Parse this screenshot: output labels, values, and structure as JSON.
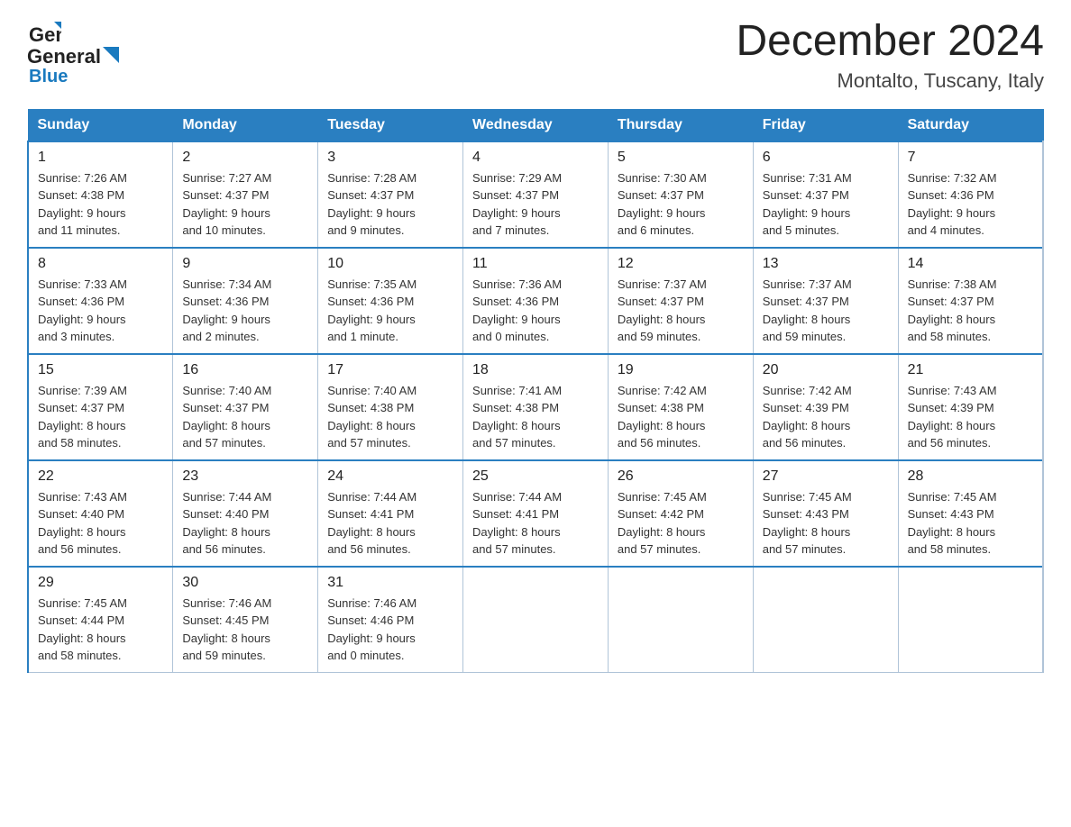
{
  "header": {
    "logo_general": "General",
    "logo_blue": "Blue",
    "title": "December 2024",
    "subtitle": "Montalto, Tuscany, Italy"
  },
  "days_of_week": [
    "Sunday",
    "Monday",
    "Tuesday",
    "Wednesday",
    "Thursday",
    "Friday",
    "Saturday"
  ],
  "weeks": [
    [
      {
        "day": "1",
        "sunrise": "7:26 AM",
        "sunset": "4:38 PM",
        "daylight": "9 hours and 11 minutes."
      },
      {
        "day": "2",
        "sunrise": "7:27 AM",
        "sunset": "4:37 PM",
        "daylight": "9 hours and 10 minutes."
      },
      {
        "day": "3",
        "sunrise": "7:28 AM",
        "sunset": "4:37 PM",
        "daylight": "9 hours and 9 minutes."
      },
      {
        "day": "4",
        "sunrise": "7:29 AM",
        "sunset": "4:37 PM",
        "daylight": "9 hours and 7 minutes."
      },
      {
        "day": "5",
        "sunrise": "7:30 AM",
        "sunset": "4:37 PM",
        "daylight": "9 hours and 6 minutes."
      },
      {
        "day": "6",
        "sunrise": "7:31 AM",
        "sunset": "4:37 PM",
        "daylight": "9 hours and 5 minutes."
      },
      {
        "day": "7",
        "sunrise": "7:32 AM",
        "sunset": "4:36 PM",
        "daylight": "9 hours and 4 minutes."
      }
    ],
    [
      {
        "day": "8",
        "sunrise": "7:33 AM",
        "sunset": "4:36 PM",
        "daylight": "9 hours and 3 minutes."
      },
      {
        "day": "9",
        "sunrise": "7:34 AM",
        "sunset": "4:36 PM",
        "daylight": "9 hours and 2 minutes."
      },
      {
        "day": "10",
        "sunrise": "7:35 AM",
        "sunset": "4:36 PM",
        "daylight": "9 hours and 1 minute."
      },
      {
        "day": "11",
        "sunrise": "7:36 AM",
        "sunset": "4:36 PM",
        "daylight": "9 hours and 0 minutes."
      },
      {
        "day": "12",
        "sunrise": "7:37 AM",
        "sunset": "4:37 PM",
        "daylight": "8 hours and 59 minutes."
      },
      {
        "day": "13",
        "sunrise": "7:37 AM",
        "sunset": "4:37 PM",
        "daylight": "8 hours and 59 minutes."
      },
      {
        "day": "14",
        "sunrise": "7:38 AM",
        "sunset": "4:37 PM",
        "daylight": "8 hours and 58 minutes."
      }
    ],
    [
      {
        "day": "15",
        "sunrise": "7:39 AM",
        "sunset": "4:37 PM",
        "daylight": "8 hours and 58 minutes."
      },
      {
        "day": "16",
        "sunrise": "7:40 AM",
        "sunset": "4:37 PM",
        "daylight": "8 hours and 57 minutes."
      },
      {
        "day": "17",
        "sunrise": "7:40 AM",
        "sunset": "4:38 PM",
        "daylight": "8 hours and 57 minutes."
      },
      {
        "day": "18",
        "sunrise": "7:41 AM",
        "sunset": "4:38 PM",
        "daylight": "8 hours and 57 minutes."
      },
      {
        "day": "19",
        "sunrise": "7:42 AM",
        "sunset": "4:38 PM",
        "daylight": "8 hours and 56 minutes."
      },
      {
        "day": "20",
        "sunrise": "7:42 AM",
        "sunset": "4:39 PM",
        "daylight": "8 hours and 56 minutes."
      },
      {
        "day": "21",
        "sunrise": "7:43 AM",
        "sunset": "4:39 PM",
        "daylight": "8 hours and 56 minutes."
      }
    ],
    [
      {
        "day": "22",
        "sunrise": "7:43 AM",
        "sunset": "4:40 PM",
        "daylight": "8 hours and 56 minutes."
      },
      {
        "day": "23",
        "sunrise": "7:44 AM",
        "sunset": "4:40 PM",
        "daylight": "8 hours and 56 minutes."
      },
      {
        "day": "24",
        "sunrise": "7:44 AM",
        "sunset": "4:41 PM",
        "daylight": "8 hours and 56 minutes."
      },
      {
        "day": "25",
        "sunrise": "7:44 AM",
        "sunset": "4:41 PM",
        "daylight": "8 hours and 57 minutes."
      },
      {
        "day": "26",
        "sunrise": "7:45 AM",
        "sunset": "4:42 PM",
        "daylight": "8 hours and 57 minutes."
      },
      {
        "day": "27",
        "sunrise": "7:45 AM",
        "sunset": "4:43 PM",
        "daylight": "8 hours and 57 minutes."
      },
      {
        "day": "28",
        "sunrise": "7:45 AM",
        "sunset": "4:43 PM",
        "daylight": "8 hours and 58 minutes."
      }
    ],
    [
      {
        "day": "29",
        "sunrise": "7:45 AM",
        "sunset": "4:44 PM",
        "daylight": "8 hours and 58 minutes."
      },
      {
        "day": "30",
        "sunrise": "7:46 AM",
        "sunset": "4:45 PM",
        "daylight": "8 hours and 59 minutes."
      },
      {
        "day": "31",
        "sunrise": "7:46 AM",
        "sunset": "4:46 PM",
        "daylight": "9 hours and 0 minutes."
      },
      null,
      null,
      null,
      null
    ]
  ],
  "labels": {
    "sunrise": "Sunrise:",
    "sunset": "Sunset:",
    "daylight": "Daylight:"
  }
}
